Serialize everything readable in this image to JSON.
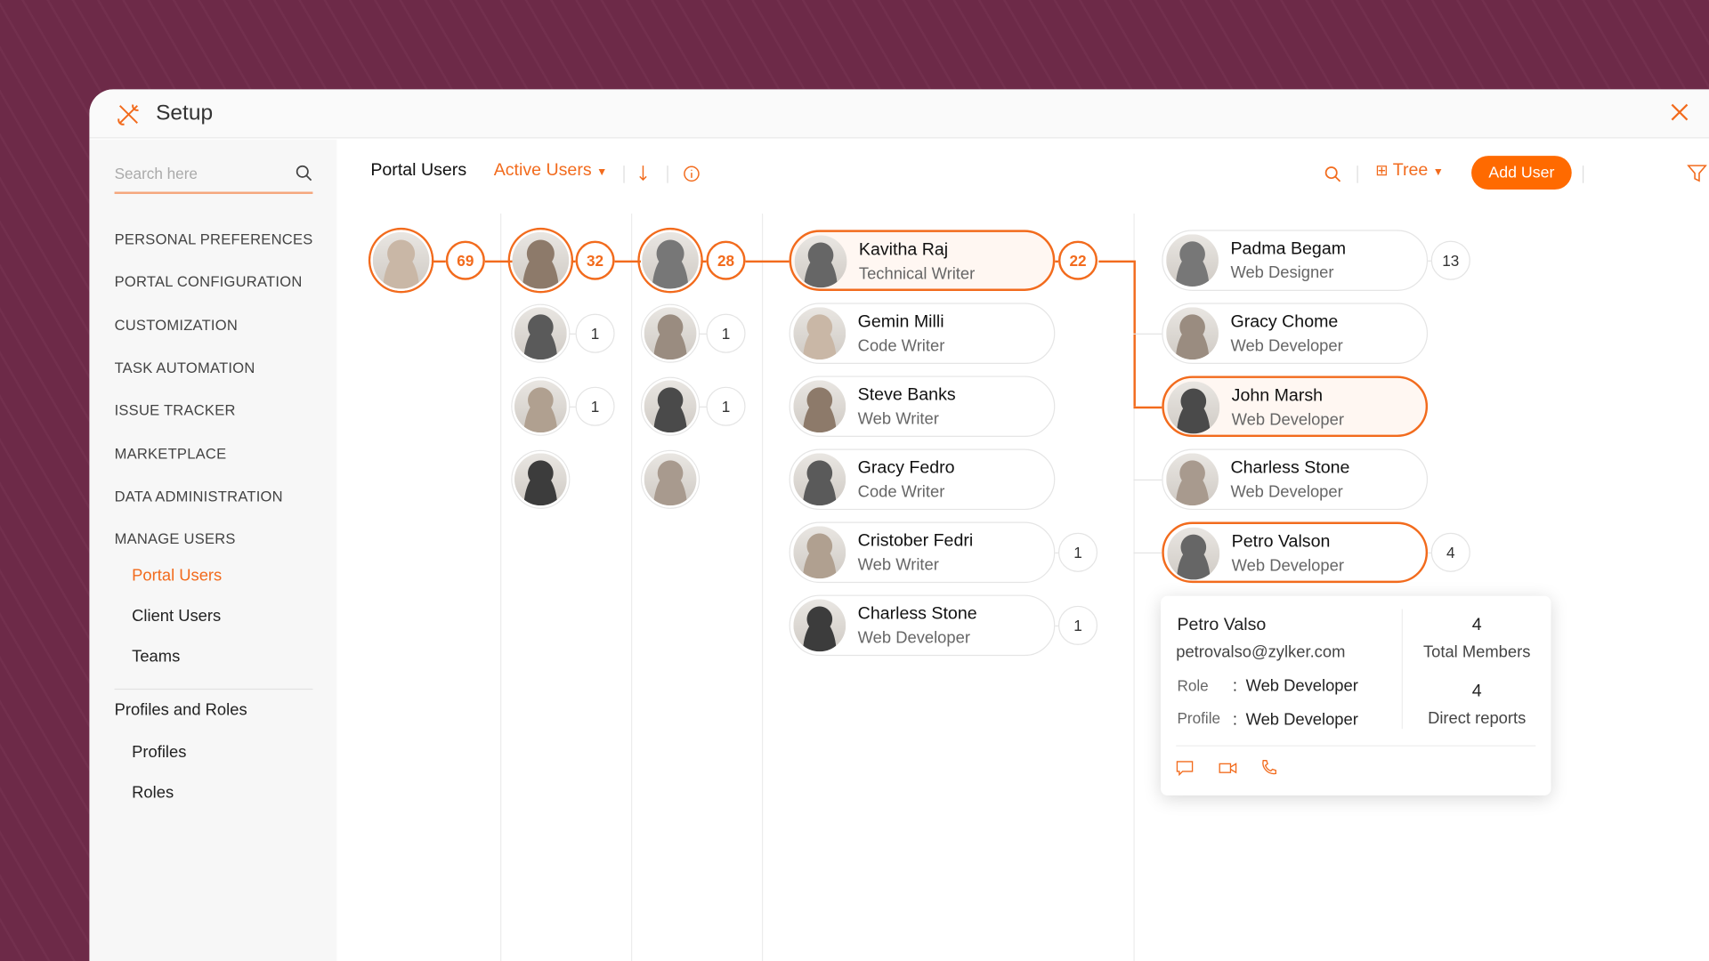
{
  "header": {
    "title": "Setup"
  },
  "sidebar": {
    "search_placeholder": "Search here",
    "sections": [
      "PERSONAL PREFERENCES",
      "PORTAL CONFIGURATION",
      "CUSTOMIZATION",
      "TASK AUTOMATION",
      "ISSUE TRACKER",
      "MARKETPLACE",
      "DATA ADMINISTRATION",
      "MANAGE USERS"
    ],
    "manage_users": [
      "Portal Users",
      "Client Users",
      "Teams"
    ],
    "profiles_heading": "Profiles and Roles",
    "profiles_items": [
      "Profiles",
      "Roles"
    ]
  },
  "toolbar": {
    "title": "Portal Users",
    "filter": "Active Users",
    "view": "Tree",
    "add_user": "Add User"
  },
  "tree": {
    "col1": [
      {
        "count": "69",
        "selected": true
      }
    ],
    "col2": [
      {
        "count": "32",
        "selected": true
      },
      {
        "count": "1"
      },
      {
        "count": "1"
      },
      {
        "count": null
      }
    ],
    "col3": [
      {
        "count": "28",
        "selected": true
      },
      {
        "count": "1"
      },
      {
        "count": "1"
      },
      {
        "count": null
      }
    ],
    "col4": [
      {
        "name": "Kavitha Raj",
        "role": "Technical Writer",
        "count": "22",
        "selected": true
      },
      {
        "name": "Gemin Milli",
        "role": "Code Writer"
      },
      {
        "name": "Steve Banks",
        "role": "Web Writer"
      },
      {
        "name": "Gracy Fedro",
        "role": "Code Writer"
      },
      {
        "name": "Cristober Fedri",
        "role": "Web Writer",
        "count": "1"
      },
      {
        "name": "Charless Stone",
        "role": "Web Developer",
        "count": "1"
      }
    ],
    "col5": [
      {
        "name": "Padma Begam",
        "role": "Web Designer",
        "count": "13"
      },
      {
        "name": "Gracy Chome",
        "role": "Web Developer"
      },
      {
        "name": "John Marsh",
        "role": "Web Developer",
        "selected": true
      },
      {
        "name": "Charless Stone",
        "role": "Web Developer"
      },
      {
        "name": "Petro Valson",
        "role": "Web Developer",
        "count": "4",
        "hover": true
      }
    ]
  },
  "popover": {
    "name": "Petro Valso",
    "email": "petrovalso@zylker.com",
    "role_label": "Role",
    "role": "Web Developer",
    "profile_label": "Profile",
    "profile": "Web Developer",
    "sep": ":",
    "total": "4",
    "total_label": "Total Members",
    "direct": "4",
    "direct_label": "Direct reports"
  },
  "colors": {
    "accent": "#f26b1d",
    "button": "#ff6a00",
    "background": "#6d2a48"
  }
}
